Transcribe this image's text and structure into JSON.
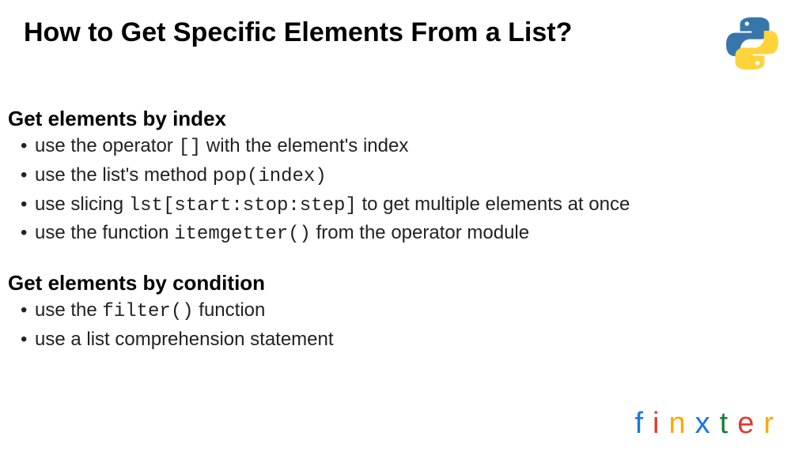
{
  "title": "How to Get Specific Elements From a List?",
  "section1": {
    "heading": "Get elements by index",
    "items": {
      "0": {
        "pre": "use the operator ",
        "code": "[]",
        "post": " with the element's index"
      },
      "1": {
        "pre": "use the list's method ",
        "code": "pop(index)",
        "post": ""
      },
      "2": {
        "pre": "use slicing ",
        "code": "lst[start:stop:step]",
        "post": " to get multiple elements at once"
      },
      "3": {
        "pre": "use the function ",
        "code": "itemgetter()",
        "post": " from the operator module"
      }
    }
  },
  "section2": {
    "heading": "Get elements by condition",
    "items": {
      "0": {
        "pre": "use the ",
        "code": "filter()",
        "post": " function"
      },
      "1": {
        "pre": "use a list comprehension statement",
        "code": "",
        "post": ""
      }
    }
  },
  "brand": {
    "f": "f",
    "i": "i",
    "n": "n",
    "x": "x",
    "t": "t",
    "e": "e",
    "r": "r"
  }
}
